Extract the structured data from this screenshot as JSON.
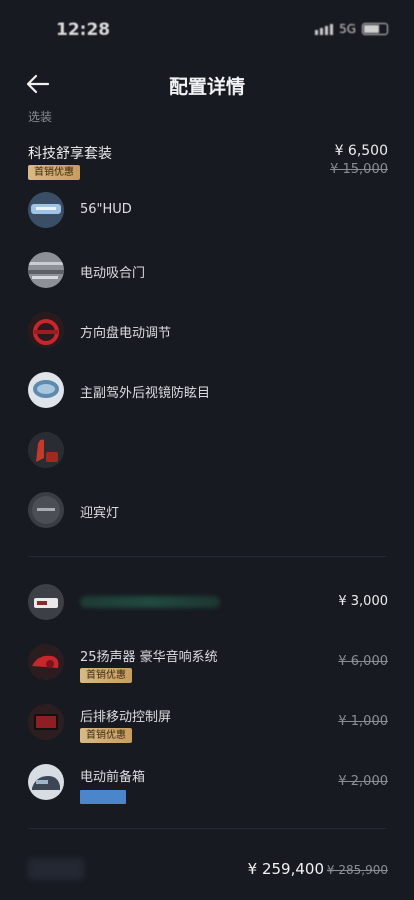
{
  "status_bar": {
    "time": "12:28",
    "network": "5G"
  },
  "header": {
    "title": "配置详情"
  },
  "section": {
    "label": "选装"
  },
  "package": {
    "name": "科技舒享套装",
    "price": "¥ 6,500",
    "original_price": "¥ 15,000",
    "badge": "首销优惠",
    "features": [
      {
        "label": "56\"HUD",
        "icon": "hud-thumb"
      },
      {
        "label": "电动吸合门",
        "icon": "door-thumb"
      },
      {
        "label": "方向盘电动调节",
        "icon": "steering-thumb"
      },
      {
        "label": "主副驾外后视镜防眩目",
        "icon": "mirror-thumb"
      },
      {
        "label": "",
        "icon": "seat-thumb"
      },
      {
        "label": "迎宾灯",
        "icon": "welcome-light-thumb"
      }
    ]
  },
  "options": [
    {
      "label": "",
      "price": "¥ 3,000",
      "strike": false,
      "badge": "",
      "icon": "accessory-thumb"
    },
    {
      "label": "25扬声器 豪华音响系统",
      "price": "¥ 6,000",
      "strike": true,
      "badge": "首销优惠",
      "icon": "speaker-thumb"
    },
    {
      "label": "后排移动控制屏",
      "price": "¥ 1,000",
      "strike": true,
      "badge": "首销优惠",
      "icon": "rear-screen-thumb"
    },
    {
      "label": "电动前备箱",
      "price": "¥ 2,000",
      "strike": true,
      "badge": "",
      "icon": "frunk-thumb"
    }
  ],
  "total": {
    "price": "¥ 259,400",
    "original_price": "¥ 285,900"
  },
  "colors": {
    "background": "#171a21",
    "badge_gold": "#d9b985",
    "blue_tag": "#4a86c9"
  }
}
